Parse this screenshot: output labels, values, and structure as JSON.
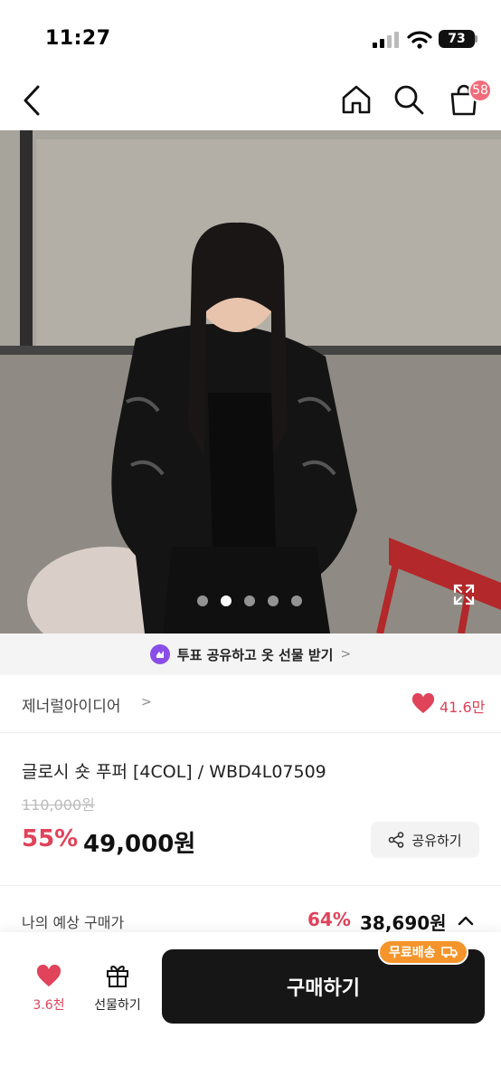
{
  "status_bar": {
    "time": "11:27",
    "battery": "73"
  },
  "nav": {
    "cart_count": "58"
  },
  "carousel": {
    "total": 5,
    "active_index": 1
  },
  "promo": {
    "text": "투표 공유하고 옷 선물 받기",
    "arrow": ">"
  },
  "brand": {
    "name": "제너럴아이디어",
    "arrow": ">",
    "likes": "41.6만"
  },
  "product": {
    "title": "글로시 숏 푸퍼 [4COL] / WBD4L07509",
    "original_price": "110,000원",
    "discount": "55%",
    "price": "49,000원",
    "share_label": "공유하기"
  },
  "expected": {
    "label": "나의 예상 구매가",
    "discount": "64%",
    "price": "38,690원"
  },
  "bottom_bar": {
    "wish_count": "3.6천",
    "gift_label": "선물하기",
    "buy_label": "구매하기",
    "free_shipping": "무료배송"
  },
  "colors": {
    "accent": "#e0435a",
    "badge": "#f26b7a",
    "shipping": "#f5942a",
    "buy": "#161616",
    "promo_icon": "#8a4ee8"
  }
}
